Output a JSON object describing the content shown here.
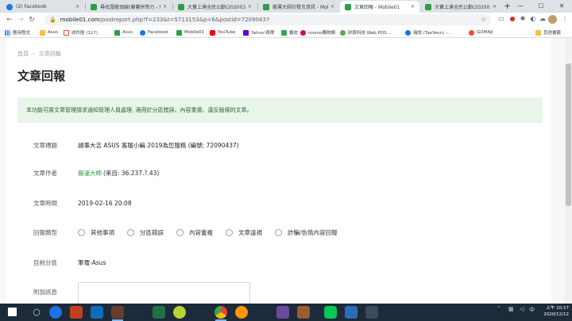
{
  "browser": {
    "tabs": [
      {
        "label": "(2) Facebook",
        "icon": "facebook-icon",
        "active": false
      },
      {
        "label": "尋找潛龍頂線(藤蔓拼哥力 - Mo",
        "icon": "mobile01-icon",
        "active": false
      },
      {
        "label": "大寶上湊全民公勤(202003 pi",
        "icon": "mobile01-icon",
        "active": false
      },
      {
        "label": "搬運大師的發言資訊 - Mobile",
        "icon": "mobile01-icon",
        "active": false
      },
      {
        "label": "文章回報 - Mobile01",
        "icon": "mobile01-icon",
        "active": true
      },
      {
        "label": "大寶上湊全民公勤(202003 pi",
        "icon": "mobile01-icon",
        "active": false
      }
    ],
    "new_tab": "+",
    "window_controls": {
      "minimize": "—",
      "maximize": "☐",
      "close": "✕"
    },
    "nav": {
      "back": "←",
      "forward": "→",
      "reload": "↻",
      "home": "⌂"
    },
    "url_domain": "mobile01.com",
    "url_path": "/postreport.php?f=233&t=5713153&p=6&postid=72090437",
    "url_star": "☆",
    "bookmarks": [
      {
        "label": "應用程式",
        "icon": "apps-grid-icon"
      },
      {
        "label": "Asus",
        "icon": "folder-icon"
      },
      {
        "label": "收件匣 (117)",
        "icon": "gmail-icon"
      },
      {
        "label": "Asus",
        "icon": "mobile01-icon"
      },
      {
        "label": "Facebook",
        "icon": "facebook-icon"
      },
      {
        "label": "Mobile01",
        "icon": "mobile01-icon"
      },
      {
        "label": "YouTube",
        "icon": "youtube-icon"
      },
      {
        "label": "Yahoo!奇摩",
        "icon": "yahoo-icon"
      },
      {
        "label": "蝦皮",
        "icon": "google-docs-icon"
      },
      {
        "label": "momo購物網",
        "icon": "momo-icon"
      },
      {
        "label": "矽穀科技 Web POS...",
        "icon": "sprout-icon"
      },
      {
        "label": "瑞悅 (TaeYeon) -...",
        "icon": "globe-icon"
      },
      {
        "label": "GOMAJI",
        "icon": "shop-icon"
      },
      {
        "label": "其他書籤",
        "icon": "folder-icon"
      }
    ]
  },
  "page": {
    "breadcrumb": [
      "首頁",
      "文章回報"
    ],
    "title": "文章回報",
    "notice": "本功能可將文章管理請求通知管理人員處理, 適用於分區錯誤、內容重複、違反版規的文章。",
    "fields": {
      "subject_label": "文章標題",
      "subject_value": "請事大吉 ASUS 客服小編 2019為您服務 (編號: 72090437)",
      "author_label": "文章作者",
      "author_name": "搬運大師",
      "author_ip": "(來自: 36.237.?.43)",
      "time_label": "文章時間",
      "time_value": "2019-02-16 20:08",
      "type_label": "回報類型",
      "type_options": [
        "其他事項",
        "分區錯誤",
        "內容重複",
        "文章違規",
        "詐騙/色情內容回報"
      ],
      "board_label": "目前分區",
      "board_value": "筆電-Asus",
      "message_label": "附加訊息"
    }
  },
  "taskbar": {
    "clock_time": "上午 10:17",
    "clock_date": "2020/12/12",
    "apps": [
      "search-icon",
      "edge-icon",
      "powerpoint-icon",
      "outlook-icon",
      "game-icon",
      "excel-icon",
      "ball-icon",
      "chrome-icon",
      "firefox-icon",
      "photo-icon",
      "line-icon",
      "mail-icon",
      "settings-icon"
    ]
  }
}
